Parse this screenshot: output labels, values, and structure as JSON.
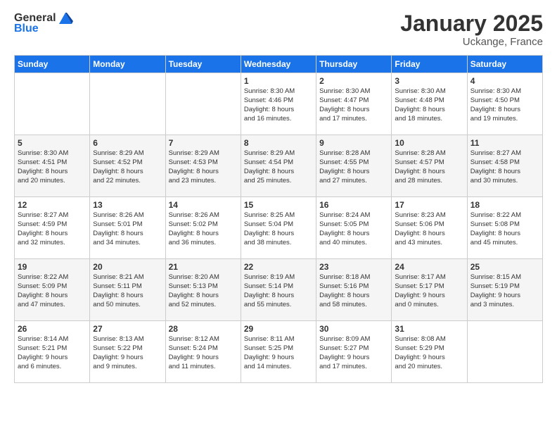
{
  "logo": {
    "general": "General",
    "blue": "Blue"
  },
  "title": "January 2025",
  "subtitle": "Uckange, France",
  "weekdays": [
    "Sunday",
    "Monday",
    "Tuesday",
    "Wednesday",
    "Thursday",
    "Friday",
    "Saturday"
  ],
  "weeks": [
    [
      {
        "day": "",
        "info": ""
      },
      {
        "day": "",
        "info": ""
      },
      {
        "day": "",
        "info": ""
      },
      {
        "day": "1",
        "info": "Sunrise: 8:30 AM\nSunset: 4:46 PM\nDaylight: 8 hours\nand 16 minutes."
      },
      {
        "day": "2",
        "info": "Sunrise: 8:30 AM\nSunset: 4:47 PM\nDaylight: 8 hours\nand 17 minutes."
      },
      {
        "day": "3",
        "info": "Sunrise: 8:30 AM\nSunset: 4:48 PM\nDaylight: 8 hours\nand 18 minutes."
      },
      {
        "day": "4",
        "info": "Sunrise: 8:30 AM\nSunset: 4:50 PM\nDaylight: 8 hours\nand 19 minutes."
      }
    ],
    [
      {
        "day": "5",
        "info": "Sunrise: 8:30 AM\nSunset: 4:51 PM\nDaylight: 8 hours\nand 20 minutes."
      },
      {
        "day": "6",
        "info": "Sunrise: 8:29 AM\nSunset: 4:52 PM\nDaylight: 8 hours\nand 22 minutes."
      },
      {
        "day": "7",
        "info": "Sunrise: 8:29 AM\nSunset: 4:53 PM\nDaylight: 8 hours\nand 23 minutes."
      },
      {
        "day": "8",
        "info": "Sunrise: 8:29 AM\nSunset: 4:54 PM\nDaylight: 8 hours\nand 25 minutes."
      },
      {
        "day": "9",
        "info": "Sunrise: 8:28 AM\nSunset: 4:55 PM\nDaylight: 8 hours\nand 27 minutes."
      },
      {
        "day": "10",
        "info": "Sunrise: 8:28 AM\nSunset: 4:57 PM\nDaylight: 8 hours\nand 28 minutes."
      },
      {
        "day": "11",
        "info": "Sunrise: 8:27 AM\nSunset: 4:58 PM\nDaylight: 8 hours\nand 30 minutes."
      }
    ],
    [
      {
        "day": "12",
        "info": "Sunrise: 8:27 AM\nSunset: 4:59 PM\nDaylight: 8 hours\nand 32 minutes."
      },
      {
        "day": "13",
        "info": "Sunrise: 8:26 AM\nSunset: 5:01 PM\nDaylight: 8 hours\nand 34 minutes."
      },
      {
        "day": "14",
        "info": "Sunrise: 8:26 AM\nSunset: 5:02 PM\nDaylight: 8 hours\nand 36 minutes."
      },
      {
        "day": "15",
        "info": "Sunrise: 8:25 AM\nSunset: 5:04 PM\nDaylight: 8 hours\nand 38 minutes."
      },
      {
        "day": "16",
        "info": "Sunrise: 8:24 AM\nSunset: 5:05 PM\nDaylight: 8 hours\nand 40 minutes."
      },
      {
        "day": "17",
        "info": "Sunrise: 8:23 AM\nSunset: 5:06 PM\nDaylight: 8 hours\nand 43 minutes."
      },
      {
        "day": "18",
        "info": "Sunrise: 8:22 AM\nSunset: 5:08 PM\nDaylight: 8 hours\nand 45 minutes."
      }
    ],
    [
      {
        "day": "19",
        "info": "Sunrise: 8:22 AM\nSunset: 5:09 PM\nDaylight: 8 hours\nand 47 minutes."
      },
      {
        "day": "20",
        "info": "Sunrise: 8:21 AM\nSunset: 5:11 PM\nDaylight: 8 hours\nand 50 minutes."
      },
      {
        "day": "21",
        "info": "Sunrise: 8:20 AM\nSunset: 5:13 PM\nDaylight: 8 hours\nand 52 minutes."
      },
      {
        "day": "22",
        "info": "Sunrise: 8:19 AM\nSunset: 5:14 PM\nDaylight: 8 hours\nand 55 minutes."
      },
      {
        "day": "23",
        "info": "Sunrise: 8:18 AM\nSunset: 5:16 PM\nDaylight: 8 hours\nand 58 minutes."
      },
      {
        "day": "24",
        "info": "Sunrise: 8:17 AM\nSunset: 5:17 PM\nDaylight: 9 hours\nand 0 minutes."
      },
      {
        "day": "25",
        "info": "Sunrise: 8:15 AM\nSunset: 5:19 PM\nDaylight: 9 hours\nand 3 minutes."
      }
    ],
    [
      {
        "day": "26",
        "info": "Sunrise: 8:14 AM\nSunset: 5:21 PM\nDaylight: 9 hours\nand 6 minutes."
      },
      {
        "day": "27",
        "info": "Sunrise: 8:13 AM\nSunset: 5:22 PM\nDaylight: 9 hours\nand 9 minutes."
      },
      {
        "day": "28",
        "info": "Sunrise: 8:12 AM\nSunset: 5:24 PM\nDaylight: 9 hours\nand 11 minutes."
      },
      {
        "day": "29",
        "info": "Sunrise: 8:11 AM\nSunset: 5:25 PM\nDaylight: 9 hours\nand 14 minutes."
      },
      {
        "day": "30",
        "info": "Sunrise: 8:09 AM\nSunset: 5:27 PM\nDaylight: 9 hours\nand 17 minutes."
      },
      {
        "day": "31",
        "info": "Sunrise: 8:08 AM\nSunset: 5:29 PM\nDaylight: 9 hours\nand 20 minutes."
      },
      {
        "day": "",
        "info": ""
      }
    ]
  ]
}
